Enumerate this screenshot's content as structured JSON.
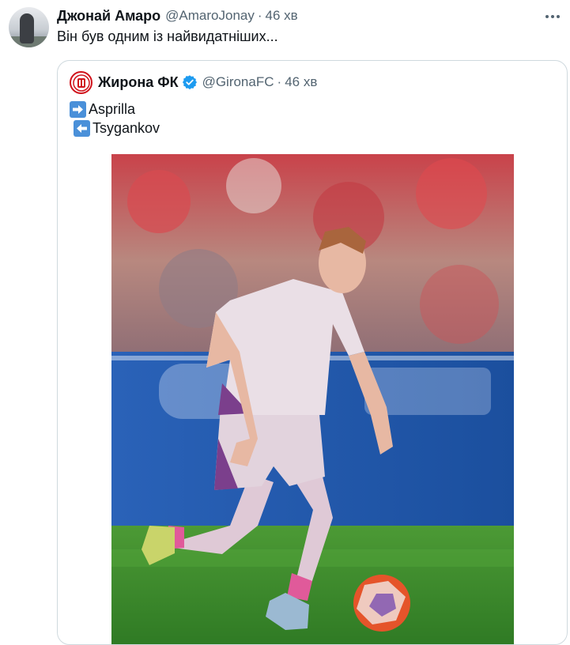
{
  "tweet": {
    "author_name": "Джонай Амаро",
    "author_handle": "@AmaroJonay",
    "separator": "·",
    "time": "46 хв",
    "text": "Він був одним із найвидатніших...",
    "more_icon": "more-dots-icon"
  },
  "quoted": {
    "author_name": "Жирона ФК",
    "author_handle": "@GironaFC",
    "separator": "·",
    "time": "46 хв",
    "verified_icon": "verified-badge-icon",
    "lines": [
      {
        "icon": "arrow-right-icon",
        "text": "Asprilla"
      },
      {
        "icon": "arrow-left-icon",
        "text": "Tsygankov"
      }
    ],
    "media": {
      "description_icon": "football-player-photo",
      "colors": {
        "grass": "#3f8a2e",
        "banner": "#1f5cb0",
        "kit": "#e9dfe6",
        "trim": "#7b3f8c",
        "ball": "#e5542a"
      }
    }
  },
  "colors": {
    "text": "#0f1419",
    "muted": "#536471",
    "border": "#cfd9de",
    "verified": "#1d9bf0",
    "arrow_box": "#4a90d9"
  }
}
